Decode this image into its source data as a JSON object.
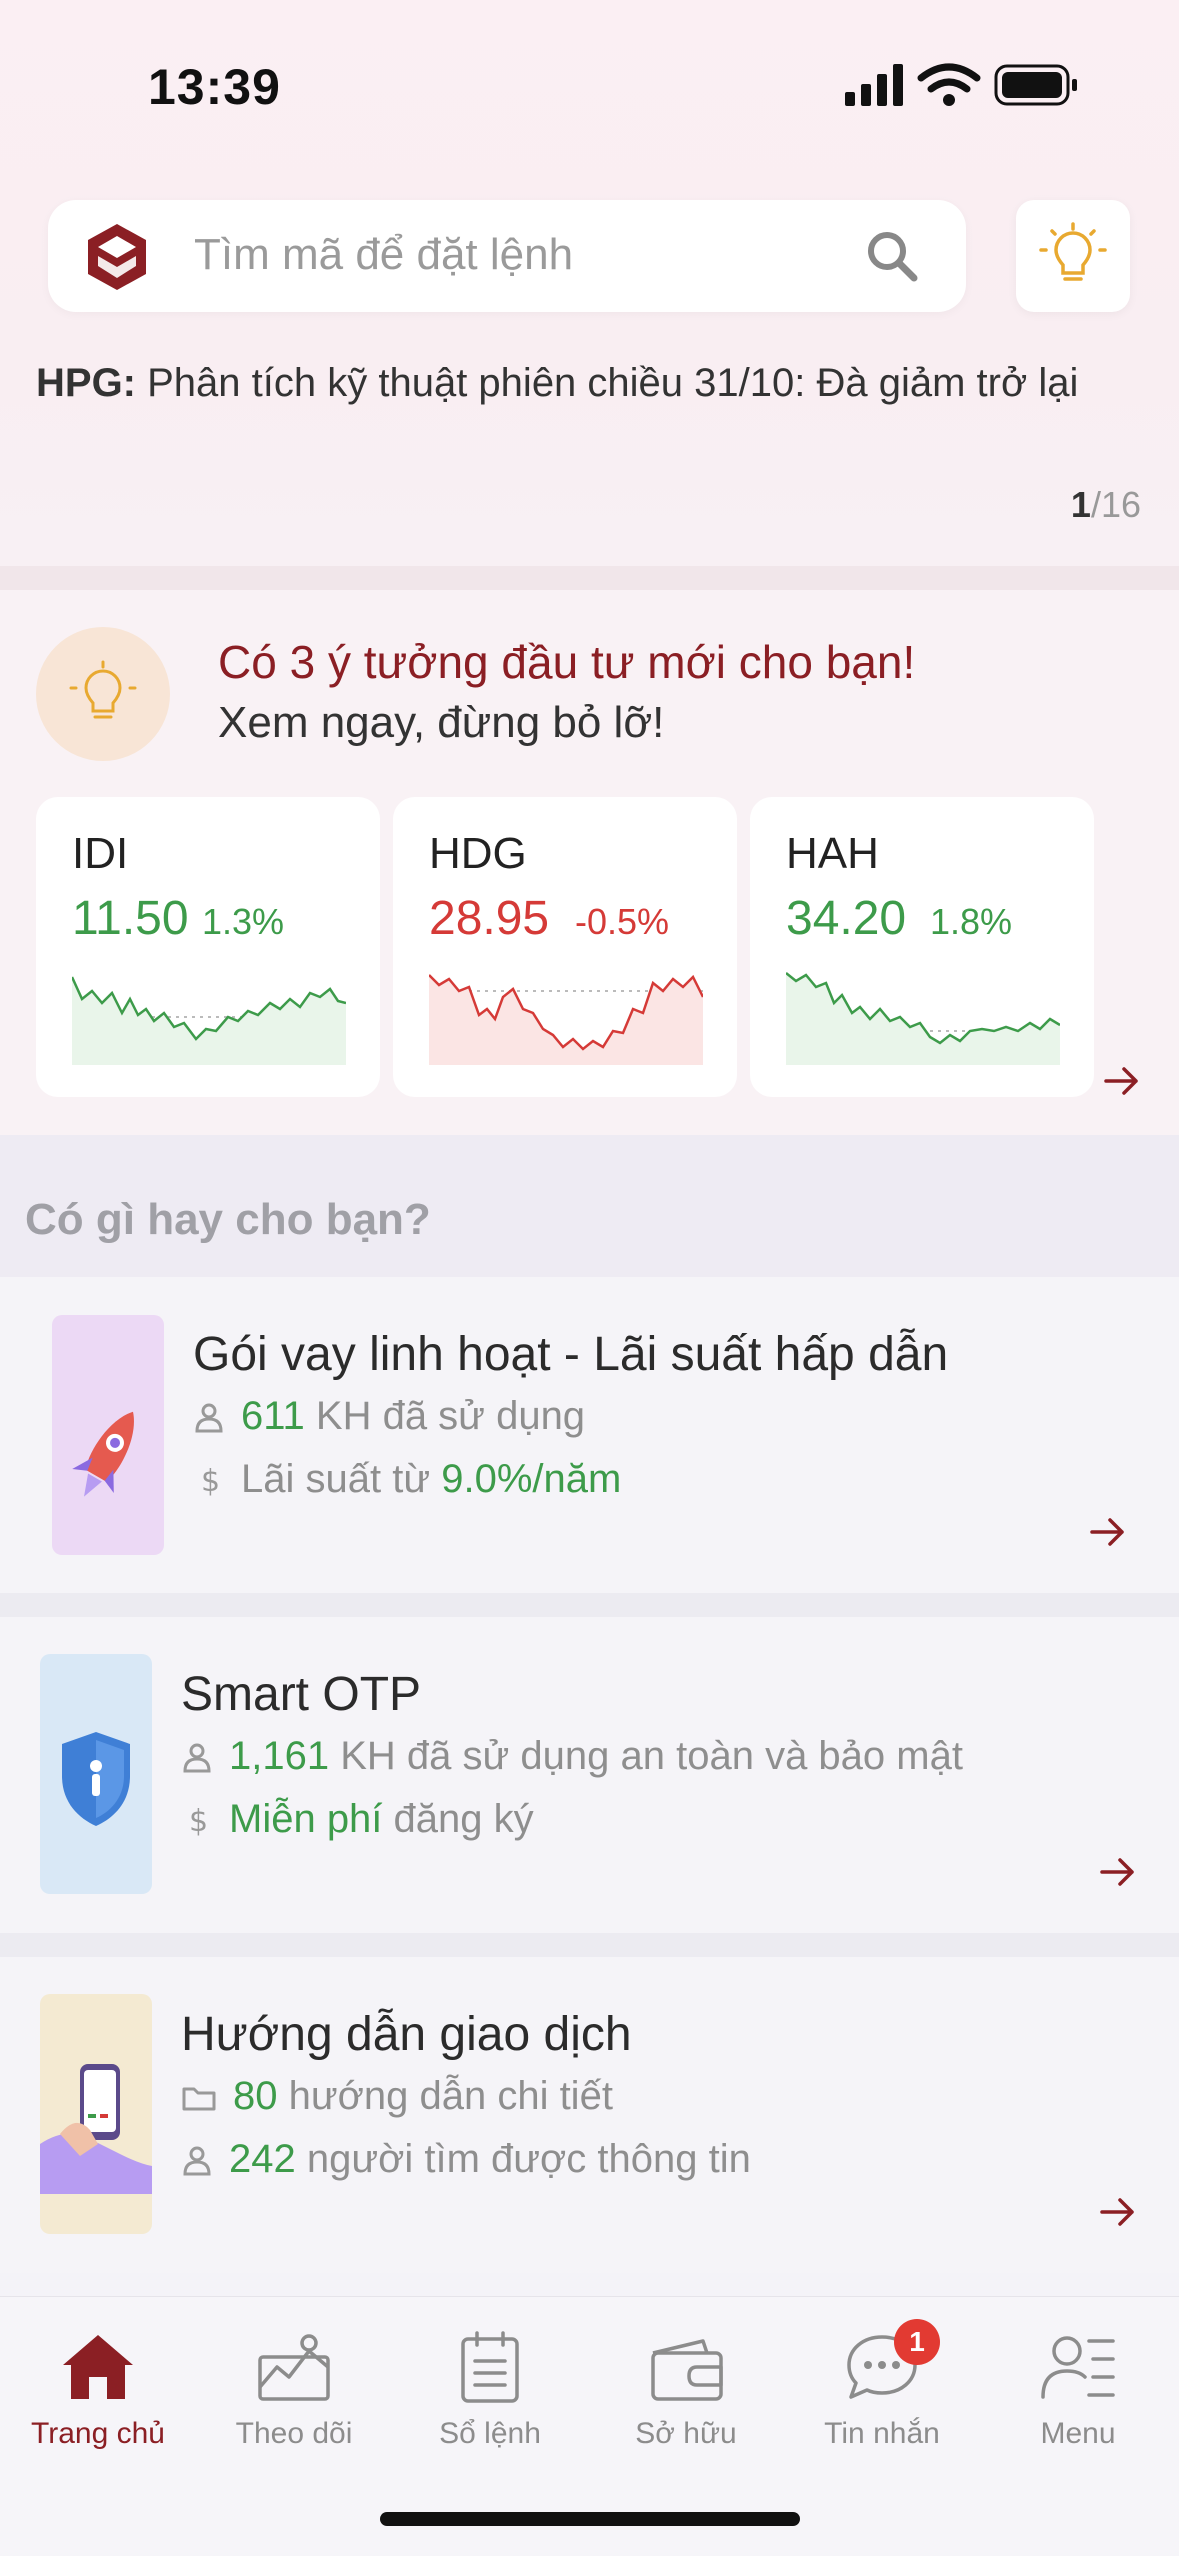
{
  "status": {
    "time": "13:39"
  },
  "search": {
    "placeholder": "Tìm mã để đặt lệnh"
  },
  "news": {
    "ticker": "HPG:",
    "headline": "Phân tích kỹ thuật phiên chiều 31/10: Đà giảm trở lại",
    "page_current": "1",
    "page_total": "/16"
  },
  "ideas": {
    "title": "Có 3 ý tưởng đầu tư mới cho bạn!",
    "subtitle": "Xem ngay, đừng bỏ lỡ!",
    "stocks": [
      {
        "code": "IDI",
        "price": "11.50",
        "change": "1.3%",
        "trend": "up"
      },
      {
        "code": "HDG",
        "price": "28.95",
        "change": "-0.5%",
        "trend": "down"
      },
      {
        "code": "HAH",
        "price": "34.20",
        "change": "1.8%",
        "trend": "up"
      }
    ]
  },
  "suggest": {
    "title": "Có gì hay cho bạn?",
    "items": [
      {
        "title": "Gói vay linh hoạt - Lãi suất hấp dẫn",
        "line1_value": "611",
        "line1_text": " KH đã sử dụng",
        "line2_text": "Lãi suất từ ",
        "line2_value": "9.0%/năm"
      },
      {
        "title": "Smart OTP",
        "line1_value": "1,161",
        "line1_text": " KH đã sử dụng an toàn và bảo mật",
        "line2_value": "Miễn phí",
        "line2_text": " đăng ký"
      },
      {
        "title": "Hướng dẫn giao dịch",
        "line1_value": "80",
        "line1_text": " hướng dẫn chi tiết",
        "line2_value": "242",
        "line2_text": " người tìm được thông tin"
      }
    ]
  },
  "nav": {
    "items": [
      {
        "label": "Trang chủ",
        "icon": "home-icon",
        "active": true
      },
      {
        "label": "Theo dõi",
        "icon": "chart-icon"
      },
      {
        "label": "Sổ lệnh",
        "icon": "order-book-icon"
      },
      {
        "label": "Sở hữu",
        "icon": "wallet-icon"
      },
      {
        "label": "Tin nhắn",
        "icon": "message-icon",
        "badge": "1"
      },
      {
        "label": "Menu",
        "icon": "menu-icon"
      }
    ]
  },
  "colors": {
    "brand": "#8b1f24",
    "up": "#3d9b4a",
    "down": "#d53a37",
    "bulb": "#e8a930"
  }
}
